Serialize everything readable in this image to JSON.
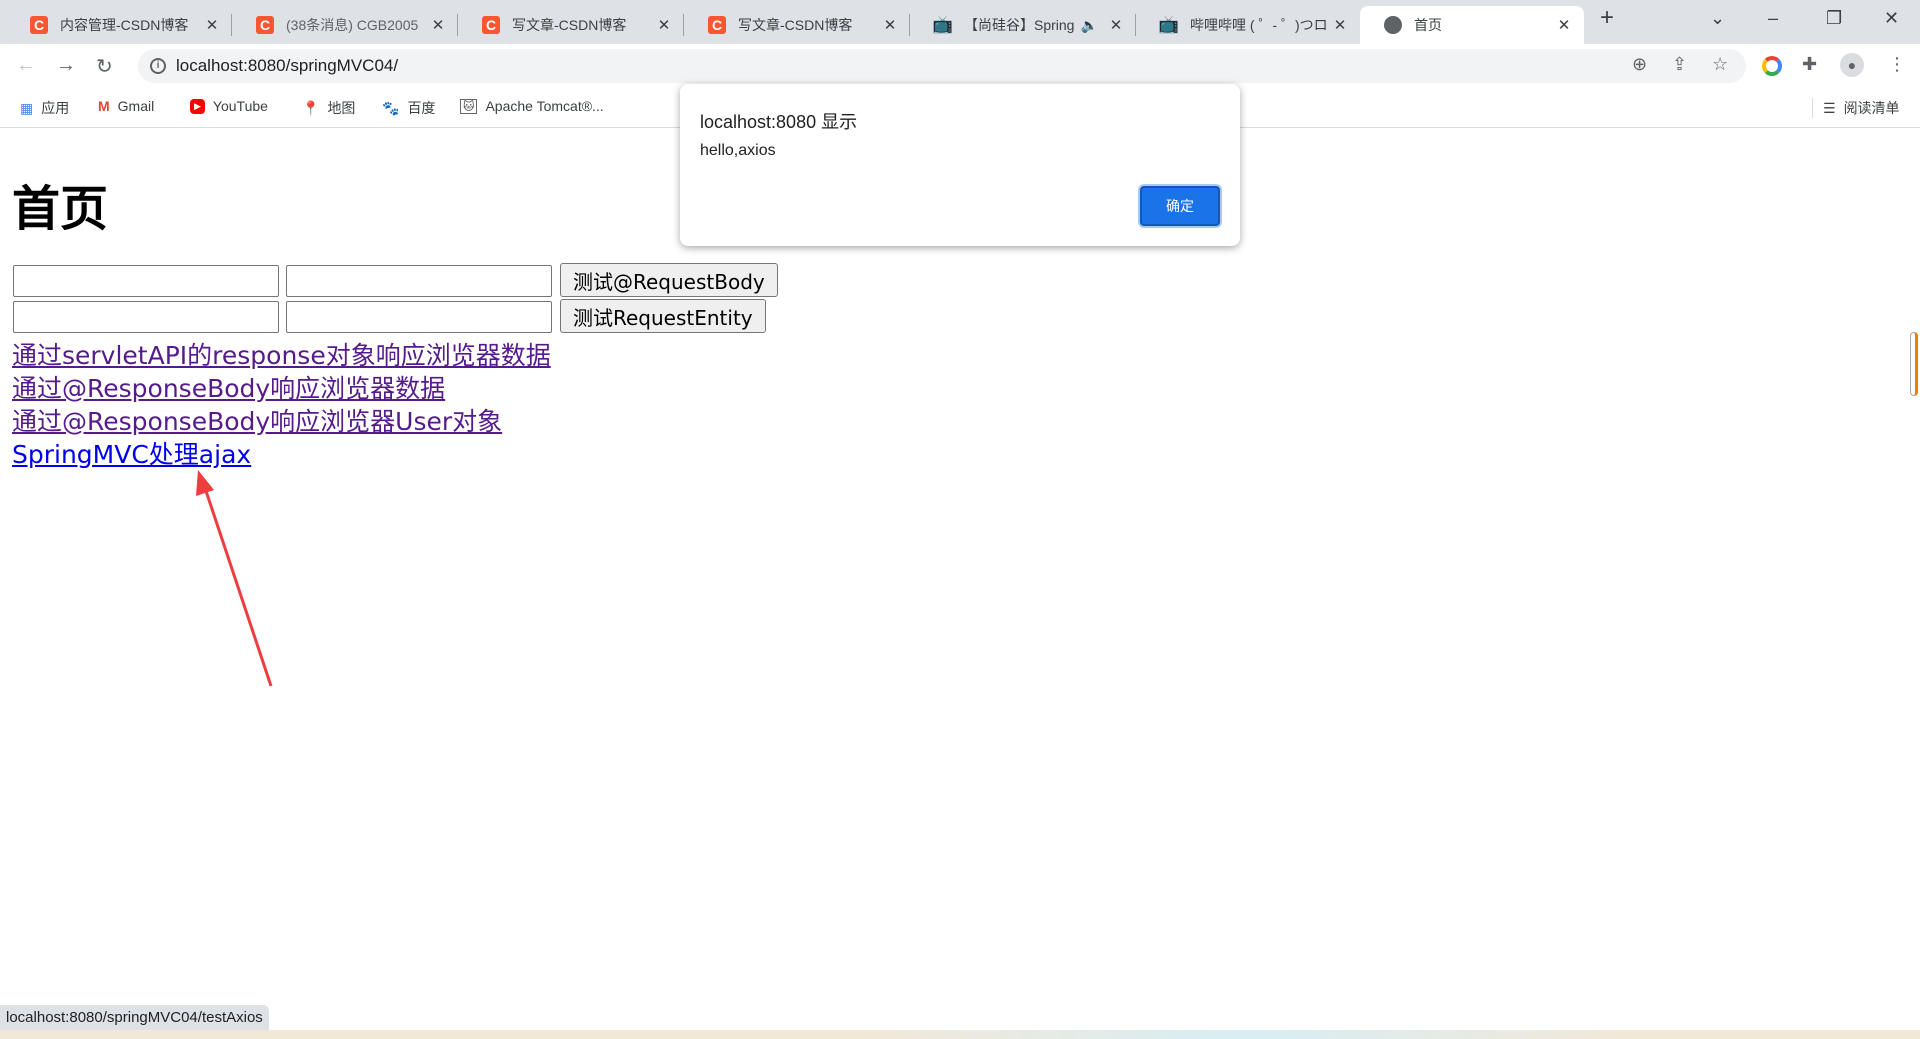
{
  "browser": {
    "tabs": [
      {
        "title": "内容管理-CSDN博客",
        "icon": "csdn-icon"
      },
      {
        "title": "(38条消息) CGB2005",
        "icon": "csdn-icon"
      },
      {
        "title": "写文章-CSDN博客",
        "icon": "csdn-icon"
      },
      {
        "title": "写文章-CSDN博客",
        "icon": "csdn-icon"
      },
      {
        "title": "【尚硅谷】Spring",
        "icon": "bilibili-icon",
        "audio": true
      },
      {
        "title": "哔哩哔哩 ( ゜- ゜)つロ",
        "icon": "bilibili-icon"
      },
      {
        "title": "首页",
        "icon": "globe-icon",
        "active": true
      }
    ],
    "url": "localhost:8080/springMVC04/",
    "bookmarks": [
      {
        "label": "应用",
        "icon": "apps-icon"
      },
      {
        "label": "Gmail",
        "icon": "gmail-icon"
      },
      {
        "label": "YouTube",
        "icon": "youtube-icon"
      },
      {
        "label": "地图",
        "icon": "maps-icon"
      },
      {
        "label": "百度",
        "icon": "baidu-icon"
      },
      {
        "label": "Apache Tomcat®...",
        "icon": "tomcat-icon"
      }
    ],
    "reading_list": "阅读清单",
    "status_url": "localhost:8080/springMVC04/testAxios"
  },
  "page": {
    "title": "首页",
    "button1": "测试@RequestBody",
    "button2": "测试RequestEntity",
    "links": [
      "通过servletAPI的response对象响应浏览器数据",
      "通过@ResponseBody响应浏览器数据",
      "通过@ResponseBody响应浏览器User对象",
      "SpringMVC处理ajax"
    ]
  },
  "dialog": {
    "title": "localhost:8080 显示",
    "message": "hello,axios",
    "ok": "确定"
  },
  "colors": {
    "accent": "#1a73e8",
    "csdn": "#fc5531",
    "link_visited": "#551a8b",
    "link": "#0000ee",
    "annotation_arrow": "#f03c3c"
  }
}
